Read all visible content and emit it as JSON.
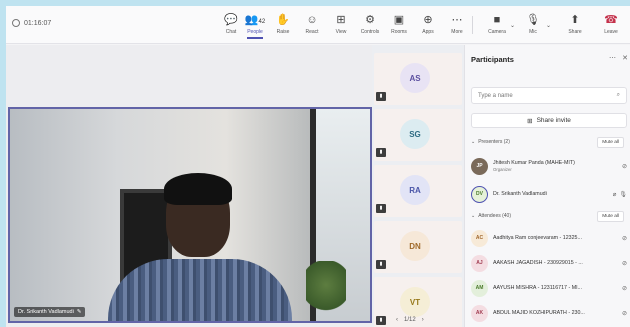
{
  "timer": "01:16:07",
  "toolbar": {
    "chat": "Chat",
    "people": "People",
    "people_count": "42",
    "raise": "Raise",
    "react": "React",
    "view": "View",
    "controls": "Controls",
    "rooms": "Rooms",
    "apps": "Apps",
    "more": "More",
    "camera": "Camera",
    "mic": "Mic",
    "share": "Share",
    "leave": "Leave"
  },
  "video": {
    "name": "Dr. Srikanth Vadlamudi"
  },
  "tiles": [
    {
      "initials": "AS",
      "bg": "#e8e3f4",
      "fg": "#5b4fa0"
    },
    {
      "initials": "SG",
      "bg": "#dcecf1",
      "fg": "#2f6c84"
    },
    {
      "initials": "RA",
      "bg": "#e2e4f6",
      "fg": "#4a55a8"
    },
    {
      "initials": "DN",
      "bg": "#f6e8d8",
      "fg": "#a06a2a"
    },
    {
      "initials": "VT",
      "bg": "#f5eed6",
      "fg": "#97791b"
    }
  ],
  "pager": {
    "text": "1/12",
    "prev": "‹",
    "next": "›"
  },
  "panel": {
    "title": "Participants",
    "search_placeholder": "Type a name",
    "share_invite": "Share invite",
    "presenters_heading": "Presenters (2)",
    "presenters_button": "Mute all",
    "attendees_heading": "Attendees (40)",
    "attendees_button": "Mute all",
    "presenters": [
      {
        "initials": "JP",
        "name": "Jhitesh Kumar Panda (MAHE-MIT)",
        "sub": "Organizer",
        "bg": "#7a6a5a",
        "fg": "#ffffff"
      },
      {
        "initials": "DV",
        "name": "Dr. Srikanth Vadlamudi",
        "sub": "",
        "bg": "#e6f2d9",
        "fg": "#4a7a2a"
      }
    ],
    "attendees": [
      {
        "initials": "AC",
        "name": "Aadhitya Ram conjeevaram - 12325...",
        "bg": "#f7ead8",
        "fg": "#a0662a"
      },
      {
        "initials": "AJ",
        "name": "AAKASH JAGADISH - 230929015 - ...",
        "bg": "#f4dde2",
        "fg": "#a03a4f"
      },
      {
        "initials": "AM",
        "name": "AAYUSH MISHRA - 123116717 - MI...",
        "bg": "#e3efdb",
        "fg": "#4a7a2a"
      },
      {
        "initials": "AK",
        "name": "ABDUL MAJID KOZHIPURATH - 230...",
        "bg": "#f4dde2",
        "fg": "#a03a4f"
      }
    ]
  }
}
